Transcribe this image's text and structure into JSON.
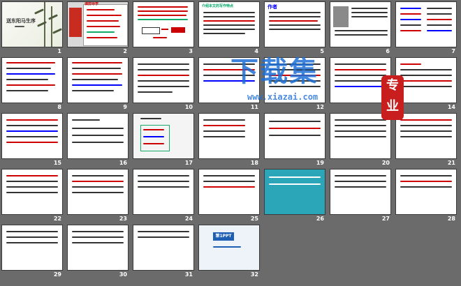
{
  "slides": [
    {
      "num": "1",
      "title": "送东阳马生序"
    },
    {
      "num": "2",
      "title": "课前导学"
    },
    {
      "num": "3",
      "title": ""
    },
    {
      "num": "4",
      "title": "介绍本文的写作特点"
    },
    {
      "num": "5",
      "title": "作者"
    },
    {
      "num": "6",
      "title": ""
    },
    {
      "num": "7",
      "title": ""
    },
    {
      "num": "8",
      "title": ""
    },
    {
      "num": "9",
      "title": ""
    },
    {
      "num": "10",
      "title": ""
    },
    {
      "num": "11",
      "title": ""
    },
    {
      "num": "12",
      "title": ""
    },
    {
      "num": "13",
      "title": ""
    },
    {
      "num": "14",
      "title": ""
    },
    {
      "num": "15",
      "title": ""
    },
    {
      "num": "16",
      "title": ""
    },
    {
      "num": "17",
      "title": ""
    },
    {
      "num": "18",
      "title": ""
    },
    {
      "num": "19",
      "title": ""
    },
    {
      "num": "20",
      "title": ""
    },
    {
      "num": "21",
      "title": ""
    },
    {
      "num": "22",
      "title": ""
    },
    {
      "num": "23",
      "title": ""
    },
    {
      "num": "24",
      "title": ""
    },
    {
      "num": "25",
      "title": ""
    },
    {
      "num": "26",
      "title": ""
    },
    {
      "num": "27",
      "title": ""
    },
    {
      "num": "28",
      "title": ""
    },
    {
      "num": "29",
      "title": ""
    },
    {
      "num": "30",
      "title": ""
    },
    {
      "num": "31",
      "title": ""
    },
    {
      "num": "32",
      "title": ""
    }
  ],
  "watermark": {
    "main": "下载集",
    "url": "www.xiazai.com",
    "badge": "专业"
  },
  "ppt_logo": "第1PPT"
}
